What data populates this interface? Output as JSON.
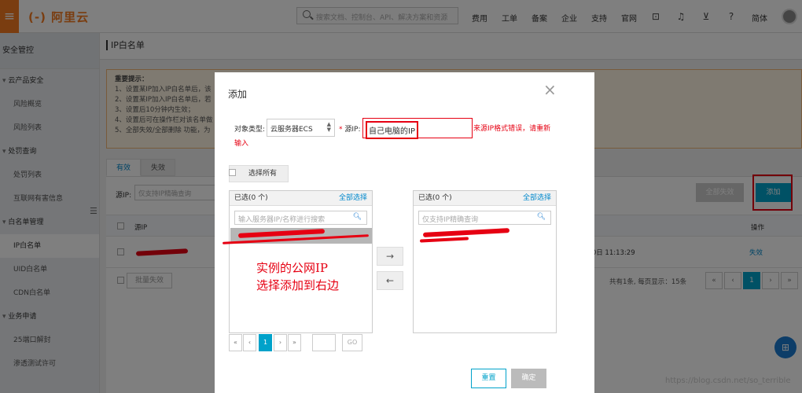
{
  "topbar": {
    "logo": "(-) 阿里云",
    "search_placeholder": "搜索文档、控制台、API、解决方案和资源",
    "nav": [
      "费用",
      "工单",
      "备案",
      "企业",
      "支持",
      "官网"
    ],
    "lang": "简体",
    "icons": [
      "terminal-icon",
      "bell-icon",
      "cart-icon",
      "help-icon"
    ]
  },
  "sidebar": {
    "title": "安全管控",
    "groups": [
      {
        "label": "云产品安全",
        "items": [
          "风险概览",
          "风险列表"
        ]
      },
      {
        "label": "处罚查询",
        "items": [
          "处罚列表",
          "互联网有害信息"
        ]
      },
      {
        "label": "白名单管理",
        "items": [
          "IP白名单",
          "UID白名单",
          "CDN白名单"
        ]
      },
      {
        "label": "业务申请",
        "items": [
          "25端口解封",
          "渗透测试许可"
        ]
      }
    ],
    "active_item": "IP白名单"
  },
  "page": {
    "title": "IP白名单",
    "notice": {
      "title": "重要提示：",
      "lines": [
        "1、设置某IP加入IP白名单后，该",
        "2、设置某IP加入IP白名单后，若",
        "3、设置后10分钟内生效；",
        "4、设置后可在操作栏对该名单做",
        "5、全部失效/全部删除 功能，为"
      ]
    },
    "tabs": [
      "有效",
      "失效"
    ],
    "filter_label": "源IP:",
    "filter_placeholder": "仅支持IP精确查询",
    "btn_disable_all": "全部失效",
    "btn_add": "添加",
    "table": {
      "headers": [
        "源IP",
        "时间",
        "操作"
      ],
      "rows": [
        {
          "time": "年4月30日 11:13:29",
          "action": "失效"
        }
      ]
    },
    "btn_batch_disable": "批量失效",
    "pagination_info": "共有1条, 每页显示：15条",
    "pages": [
      "«",
      "‹",
      "1",
      "›",
      "»"
    ]
  },
  "modal": {
    "title": "添加",
    "type_label": "对象类型:",
    "type_value": "云服务器ECS",
    "ip_label_req": "*",
    "ip_label": "源IP:",
    "ip_value": "自己电脑的IP",
    "error": "来源IP格式错误，请重新输入",
    "select_all": "选择所有",
    "left_box": {
      "header": "已选(0 个)",
      "select_all": "全部选择",
      "search_placeholder": "输入服务器IP/名称进行搜索"
    },
    "right_box": {
      "header": "已选(0 个)",
      "select_all": "全部选择",
      "search_placeholder": "仅支持IP精确查询"
    },
    "annotation": "实例的公网IP\n选择添加到右边",
    "pagination": [
      "«",
      "‹",
      "1",
      "›",
      "»"
    ],
    "go": "GO",
    "btn_reset": "重置",
    "btn_ok": "确定"
  },
  "watermark": "https://blog.csdn.net/so_terrible",
  "colors": {
    "brand": "#f47a20",
    "accent": "#00a2ca",
    "error": "#e60012"
  }
}
